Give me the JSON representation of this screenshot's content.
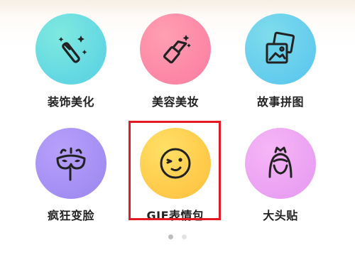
{
  "features": [
    {
      "label": "装饰美化",
      "icon": "magic-wand-icon",
      "colors": [
        "#6ee0d8",
        "#5ad1e6"
      ]
    },
    {
      "label": "美容美妆",
      "icon": "lipstick-icon",
      "colors": [
        "#ff8fa3",
        "#ff7fa8"
      ]
    },
    {
      "label": "故事拼图",
      "icon": "photo-collage-icon",
      "colors": [
        "#6fd3e6",
        "#5dc6f0"
      ]
    },
    {
      "label": "疯狂变脸",
      "icon": "masquerade-mask-icon",
      "colors": [
        "#a98ff7",
        "#9f8cf0"
      ]
    },
    {
      "label": "GIF表情包",
      "icon": "winking-face-icon",
      "colors": [
        "#ffd34e",
        "#ffbf3c"
      ]
    },
    {
      "label": "大头贴",
      "icon": "princess-avatar-icon",
      "colors": [
        "#f0a8f3",
        "#e69af2"
      ]
    }
  ],
  "pager": {
    "total": 2,
    "active": 1
  },
  "colors": {
    "highlight": "#e41a22",
    "dot_active": "#bdbdbd",
    "dot_inactive": "#e3e3e3",
    "icon_stroke": "#222222"
  }
}
